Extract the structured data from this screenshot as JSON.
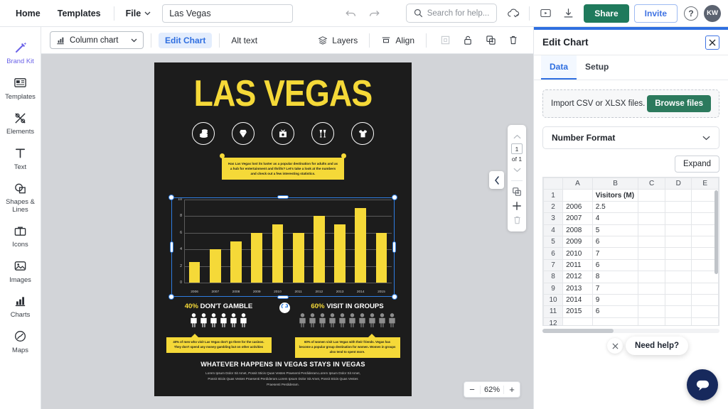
{
  "topbar": {
    "home": "Home",
    "templates": "Templates",
    "file": "File",
    "doc_name": "Las Vegas",
    "search_placeholder": "Search for help...",
    "share": "Share",
    "invite": "Invite",
    "avatar_initials": "KW",
    "help_glyph": "?"
  },
  "toolbar": {
    "chart_type": "Column chart",
    "edit_chart": "Edit Chart",
    "alt_text": "Alt text",
    "layers": "Layers",
    "align": "Align"
  },
  "sidebar": {
    "items": [
      {
        "label": "Brand Kit",
        "icon": "magic-wand-icon",
        "active": true
      },
      {
        "label": "Templates",
        "icon": "templates-icon",
        "active": false
      },
      {
        "label": "Elements",
        "icon": "elements-icon",
        "active": false
      },
      {
        "label": "Text",
        "icon": "text-icon",
        "active": false
      },
      {
        "label": "Shapes &\nLines",
        "icon": "shapes-icon",
        "active": false
      },
      {
        "label": "Icons",
        "icon": "briefcase-icon",
        "active": false
      },
      {
        "label": "Images",
        "icon": "image-icon",
        "active": false
      },
      {
        "label": "Charts",
        "icon": "bar-chart-icon",
        "active": false
      },
      {
        "label": "Maps",
        "icon": "globe-icon",
        "active": false
      }
    ]
  },
  "canvas": {
    "page_number": "1",
    "page_of": "of 1",
    "zoom_level": "62%",
    "zoom_out": "−",
    "zoom_in": "+"
  },
  "poster": {
    "title": "LAS VEGAS",
    "icons": [
      "casino-chips-icon",
      "diamond-icon",
      "gift-box-icon",
      "champagne-glasses-icon",
      "tshirt-icon"
    ],
    "intro_text": "Has Las Vegas lost its luster as a popular destination for adults and as a hub for entertainment and thrills? Let's take a look at the numbers and check out a few interesting statistics.",
    "stat_left": {
      "percent": "40%",
      "headline": "DON'T GAMBLE",
      "note": "40% of men who visit Las Vegas don't go there for the casinos. They don't spend any money gambling but on other activities",
      "people_count": 6,
      "people_color": "#ffffff"
    },
    "stat_right": {
      "percent": "60%",
      "headline": "VISIT IN GROUPS",
      "note": "60% of women visit Las Vegas with their friends. Vegas has become a popular group destination for women. Women in groups also tend to spent more.",
      "people_count": 10,
      "people_color": "#8d8d8d"
    },
    "footer_title": "WHATEVER HAPPENS IN VEGAS STAYS IN VEGAS",
    "footer_text": "Lorem Ipsum Dolor Sit Amet, Possit Sticis Quas Vestes Praesenti Perdideram.Lorem Ipsum Dolor Sit Amet, Possit Sticis Quas Vestes Praesenti Perdideram.Lorem Ipsum Dolor Sit Amet, Possit Sticis Quas Vestes Praesenti Perdideram."
  },
  "chart_data": {
    "type": "bar",
    "title": "",
    "xlabel": "",
    "ylabel": "",
    "series_name": "Visitors (M)",
    "categories": [
      "2006",
      "2007",
      "2008",
      "2009",
      "2010",
      "2011",
      "2012",
      "2013",
      "2014",
      "2015"
    ],
    "values": [
      2.5,
      4,
      5,
      6,
      7,
      6,
      8,
      7,
      9,
      6
    ],
    "ylim": [
      0,
      10
    ],
    "yticks": [
      0,
      2,
      4,
      6,
      8,
      10
    ],
    "grid": true,
    "legend": "none",
    "bar_color": "#f5d938",
    "background": "#1c1c1c"
  },
  "panel": {
    "title": "Edit Chart",
    "tabs": [
      {
        "label": "Data",
        "active": true
      },
      {
        "label": "Setup",
        "active": false
      }
    ],
    "import_label": "Import CSV or XLSX files.",
    "browse_button": "Browse files",
    "number_format": "Number Format",
    "expand_button": "Expand",
    "sheet": {
      "columns": [
        "",
        "A",
        "B",
        "C",
        "D",
        "E"
      ],
      "rows": [
        {
          "n": "1",
          "a": "",
          "b": "Visitors (M)",
          "bold": true
        },
        {
          "n": "2",
          "a": "2006",
          "b": "2.5",
          "bold": false
        },
        {
          "n": "3",
          "a": "2007",
          "b": "4",
          "bold": false
        },
        {
          "n": "4",
          "a": "2008",
          "b": "5",
          "bold": false
        },
        {
          "n": "5",
          "a": "2009",
          "b": "6",
          "bold": false
        },
        {
          "n": "6",
          "a": "2010",
          "b": "7",
          "bold": false
        },
        {
          "n": "7",
          "a": "2011",
          "b": "6",
          "bold": false
        },
        {
          "n": "8",
          "a": "2012",
          "b": "8",
          "bold": false
        },
        {
          "n": "9",
          "a": "2013",
          "b": "7",
          "bold": false
        },
        {
          "n": "10",
          "a": "2014",
          "b": "9",
          "bold": false
        },
        {
          "n": "11",
          "a": "2015",
          "b": "6",
          "bold": false
        },
        {
          "n": "12",
          "a": "",
          "b": "",
          "bold": false
        }
      ]
    }
  },
  "chat": {
    "need_help": "Need help?"
  }
}
